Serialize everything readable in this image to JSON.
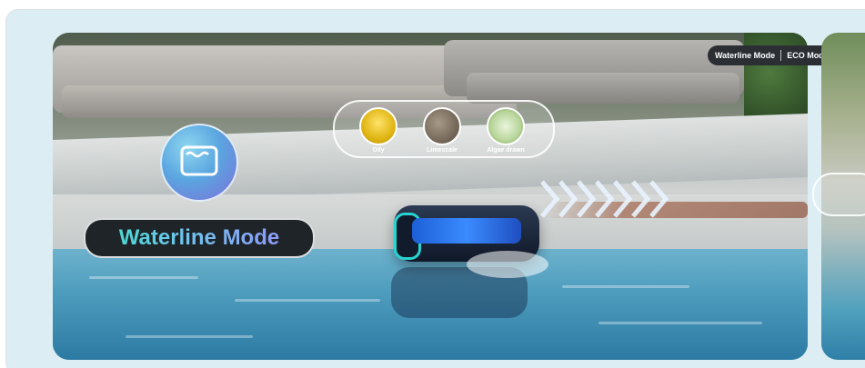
{
  "slide": {
    "mode_title": "Waterline Mode",
    "dirt_types": [
      {
        "label": "Oily",
        "color": "#e8c21a"
      },
      {
        "label": "Limescale",
        "color": "#7c6d5d"
      },
      {
        "label": "Algae drawn",
        "color": "#5d8b3a"
      }
    ]
  },
  "tabs": {
    "items": [
      "Waterline Mode",
      "ECO Mode"
    ],
    "arrow": "»»"
  }
}
